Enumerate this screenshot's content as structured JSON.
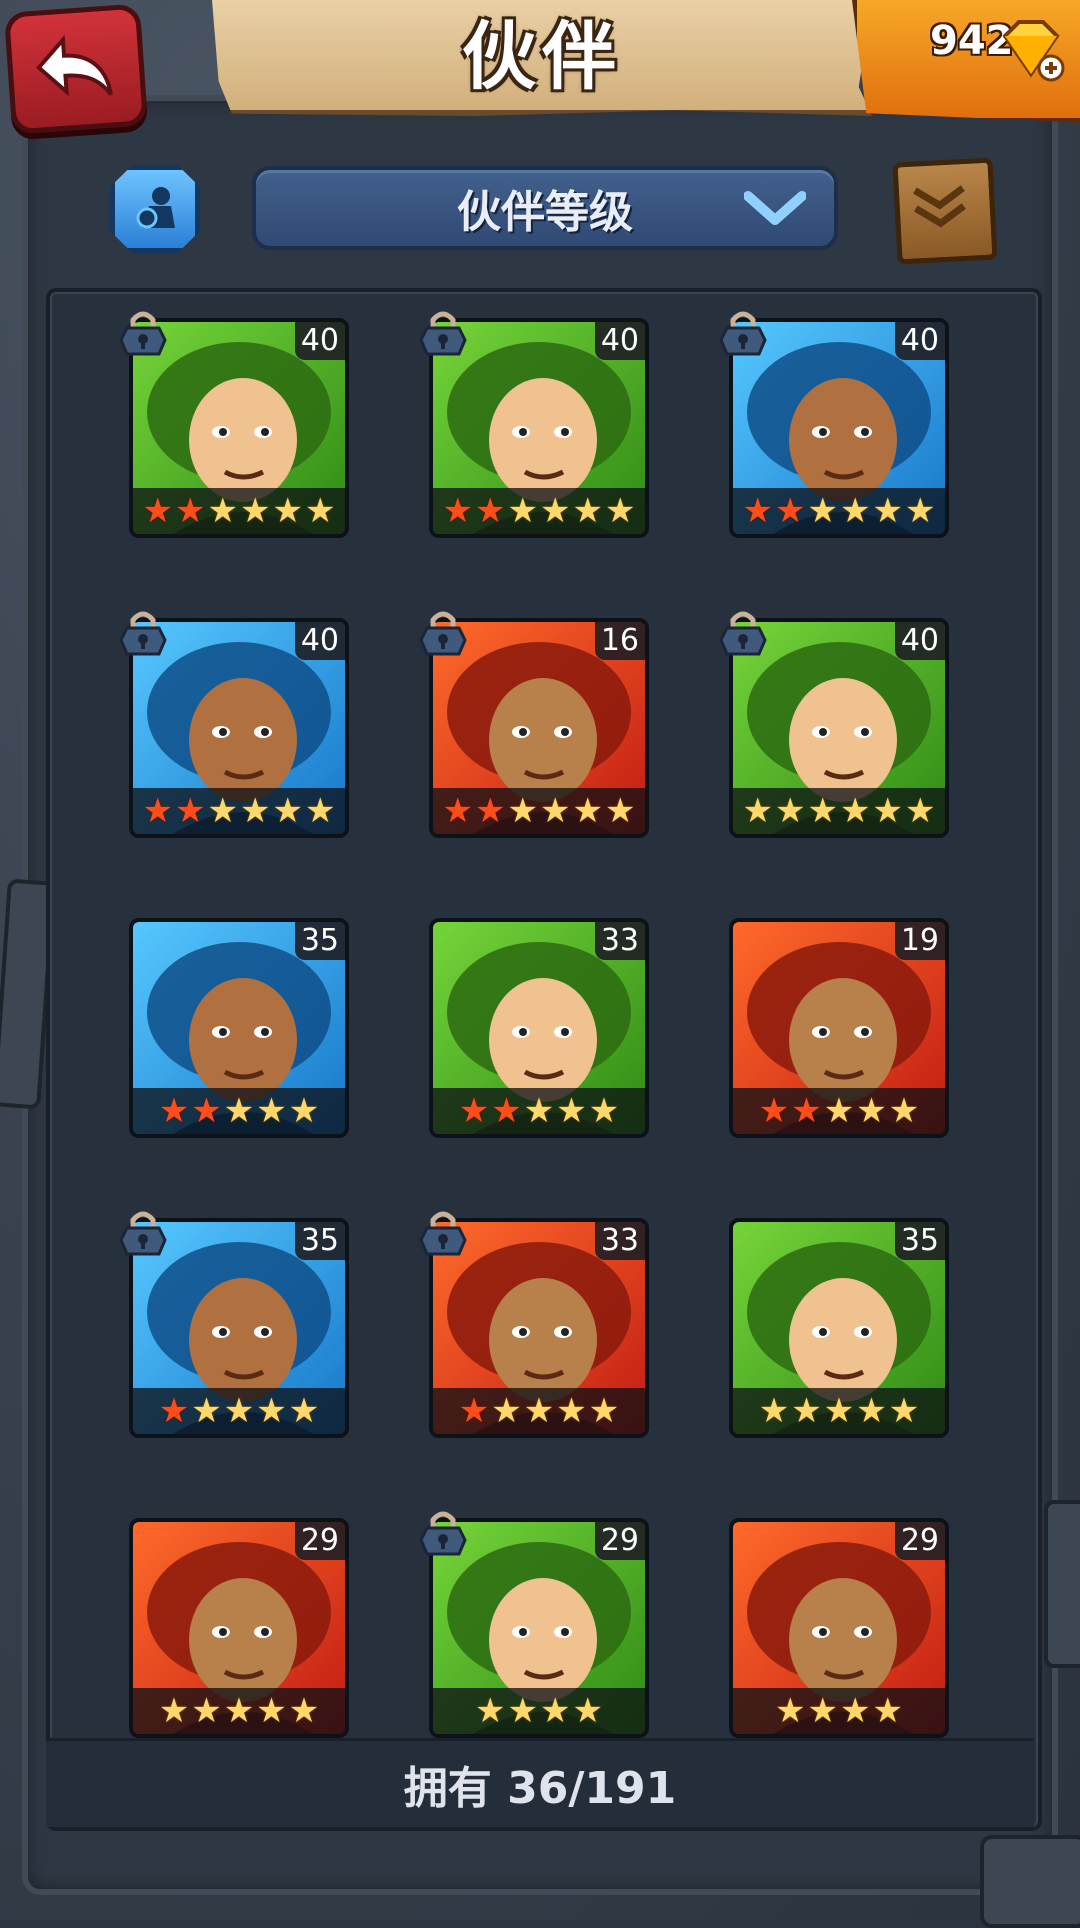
{
  "header": {
    "title": "伙伴",
    "gems": "942"
  },
  "controls": {
    "sort_label": "伙伴等级"
  },
  "companions": [
    {
      "level": "40",
      "stars": 6,
      "red_stars": 2,
      "color": "green",
      "locked": true,
      "icon": "mammoth-portrait"
    },
    {
      "level": "40",
      "stars": 6,
      "red_stars": 2,
      "color": "green",
      "locked": true,
      "icon": "elf-woman-portrait"
    },
    {
      "level": "40",
      "stars": 6,
      "red_stars": 2,
      "color": "blue",
      "locked": true,
      "icon": "bearded-warrior-portrait"
    },
    {
      "level": "40",
      "stars": 6,
      "red_stars": 2,
      "color": "blue",
      "locked": true,
      "icon": "bearded-warrior-portrait"
    },
    {
      "level": "16",
      "stars": 6,
      "red_stars": 2,
      "color": "red",
      "locked": true,
      "icon": "afro-woman-portrait"
    },
    {
      "level": "40",
      "stars": 6,
      "red_stars": 0,
      "color": "green",
      "locked": true,
      "icon": "lizard-portrait"
    },
    {
      "level": "35",
      "stars": 5,
      "red_stars": 2,
      "color": "blue",
      "locked": false,
      "icon": "blue-hair-warrior-portrait"
    },
    {
      "level": "33",
      "stars": 5,
      "red_stars": 2,
      "color": "green",
      "locked": false,
      "icon": "mohawk-orc-portrait"
    },
    {
      "level": "19",
      "stars": 5,
      "red_stars": 2,
      "color": "red",
      "locked": false,
      "icon": "long-hair-hero-portrait"
    },
    {
      "level": "35",
      "stars": 5,
      "red_stars": 1,
      "color": "blue",
      "locked": true,
      "icon": "hooded-mage-portrait"
    },
    {
      "level": "33",
      "stars": 5,
      "red_stars": 1,
      "color": "red",
      "locked": true,
      "icon": "brunette-woman-portrait"
    },
    {
      "level": "35",
      "stars": 5,
      "red_stars": 0,
      "color": "green",
      "locked": false,
      "icon": "headband-woman-portrait"
    },
    {
      "level": "29",
      "stars": 5,
      "red_stars": 0,
      "color": "red",
      "locked": false,
      "icon": "skull-totem-portrait"
    },
    {
      "level": "29",
      "stars": 4,
      "red_stars": 0,
      "color": "green",
      "locked": true,
      "icon": "pumpkin-kid-portrait"
    },
    {
      "level": "29",
      "stars": 4,
      "red_stars": 0,
      "color": "red",
      "locked": false,
      "icon": "red-crest-beast-portrait"
    }
  ],
  "footer": {
    "owned_text": "拥有 36/191"
  },
  "colors": {
    "green": "#4fb523",
    "blue": "#2b98e6",
    "red": "#e2401c",
    "gem": "#f7a827"
  }
}
